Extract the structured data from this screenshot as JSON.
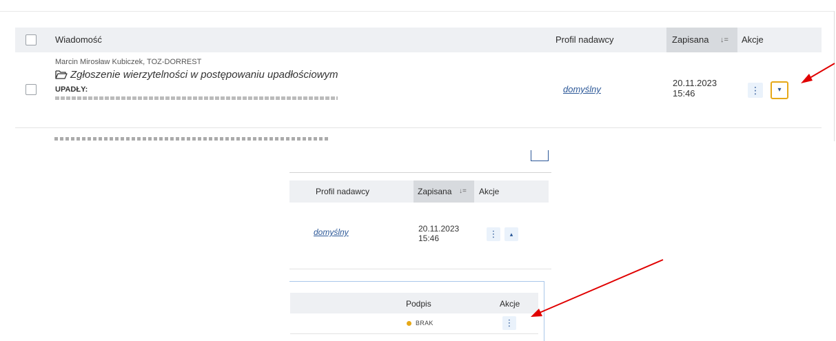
{
  "table": {
    "col_message": "Wiadomość",
    "col_sender_profile": "Profil nadawcy",
    "col_saved": "Zapisana",
    "col_actions": "Akcje"
  },
  "message": {
    "sender": "Marcin Mirosław Kubiczek, TOZ-DORREST",
    "subject": "Zgłoszenie wierzytelności w postępowaniu upadłościowym",
    "label": "UPADŁY:",
    "sender_profile": "domyślny",
    "date": "20.11.2023",
    "time": "15:46"
  },
  "expanded": {
    "sender_profile": "domyślny",
    "date": "20.11.2023",
    "time": "15:46"
  },
  "attachments": {
    "col_signature": "Podpis",
    "col_actions": "Akcje",
    "signature_status": "BRAK"
  },
  "icons": {
    "kebab": "⋮",
    "expand_down": "▾",
    "collapse_up": "▴",
    "sort": "↓="
  },
  "colors": {
    "accent_border": "#e6a817",
    "link": "#2b5797",
    "arrow": "#e00000",
    "status_missing": "#e6a817"
  }
}
